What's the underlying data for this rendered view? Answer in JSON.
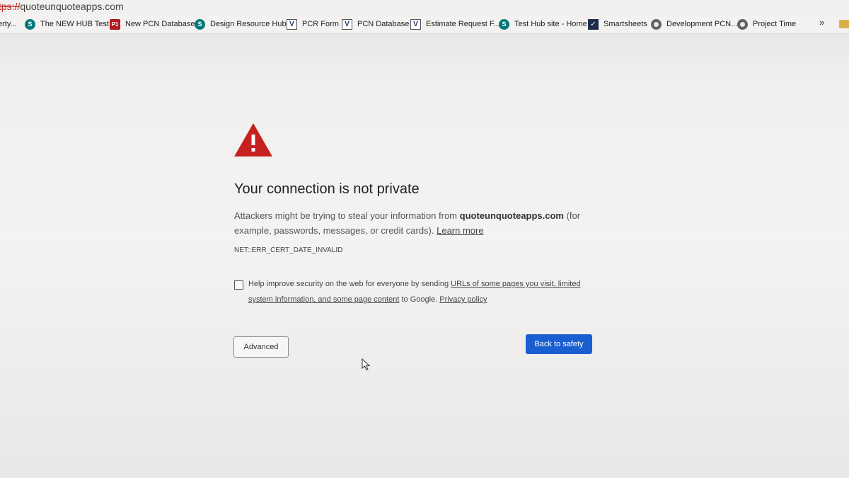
{
  "browser": {
    "url_scheme": "tps://",
    "url_host": "quoteunquoteapps.com",
    "bookmarks": [
      {
        "label": "erty...",
        "icon": "none"
      },
      {
        "label": "The NEW HUB Test",
        "icon": "sharepoint-icon"
      },
      {
        "label": "New PCN Database",
        "icon": "p1-icon"
      },
      {
        "label": "Design Resource Hub",
        "icon": "sharepoint-icon"
      },
      {
        "label": "PCR Form",
        "icon": "v-icon"
      },
      {
        "label": "PCN Database",
        "icon": "v-icon"
      },
      {
        "label": "Estimate Request F...",
        "icon": "v-icon"
      },
      {
        "label": "Test Hub site - Home",
        "icon": "sharepoint-icon"
      },
      {
        "label": "Smartsheets",
        "icon": "smartsheet-icon"
      },
      {
        "label": "Development PCN...",
        "icon": "globe-icon"
      },
      {
        "label": "Project Time",
        "icon": "globe-icon"
      }
    ],
    "overflow_label": "»"
  },
  "interstitial": {
    "title": "Your connection is not private",
    "desc_before": "Attackers might be trying to steal your information from ",
    "domain": "quoteunquoteapps.com",
    "desc_after": " (for example, passwords, messages, or credit cards). ",
    "learn_more": "Learn more",
    "error_code": "NET::ERR_CERT_DATE_INVALID",
    "optin_before": "Help improve security on the web for everyone by sending ",
    "optin_link": "URLs of some pages you visit, limited system information, and some page content",
    "optin_mid": " to Google. ",
    "privacy_link": "Privacy policy",
    "advanced_label": "Advanced",
    "back_label": "Back to safety"
  },
  "colors": {
    "warning_red": "#c5221f",
    "primary_button": "#1a5fd2"
  }
}
